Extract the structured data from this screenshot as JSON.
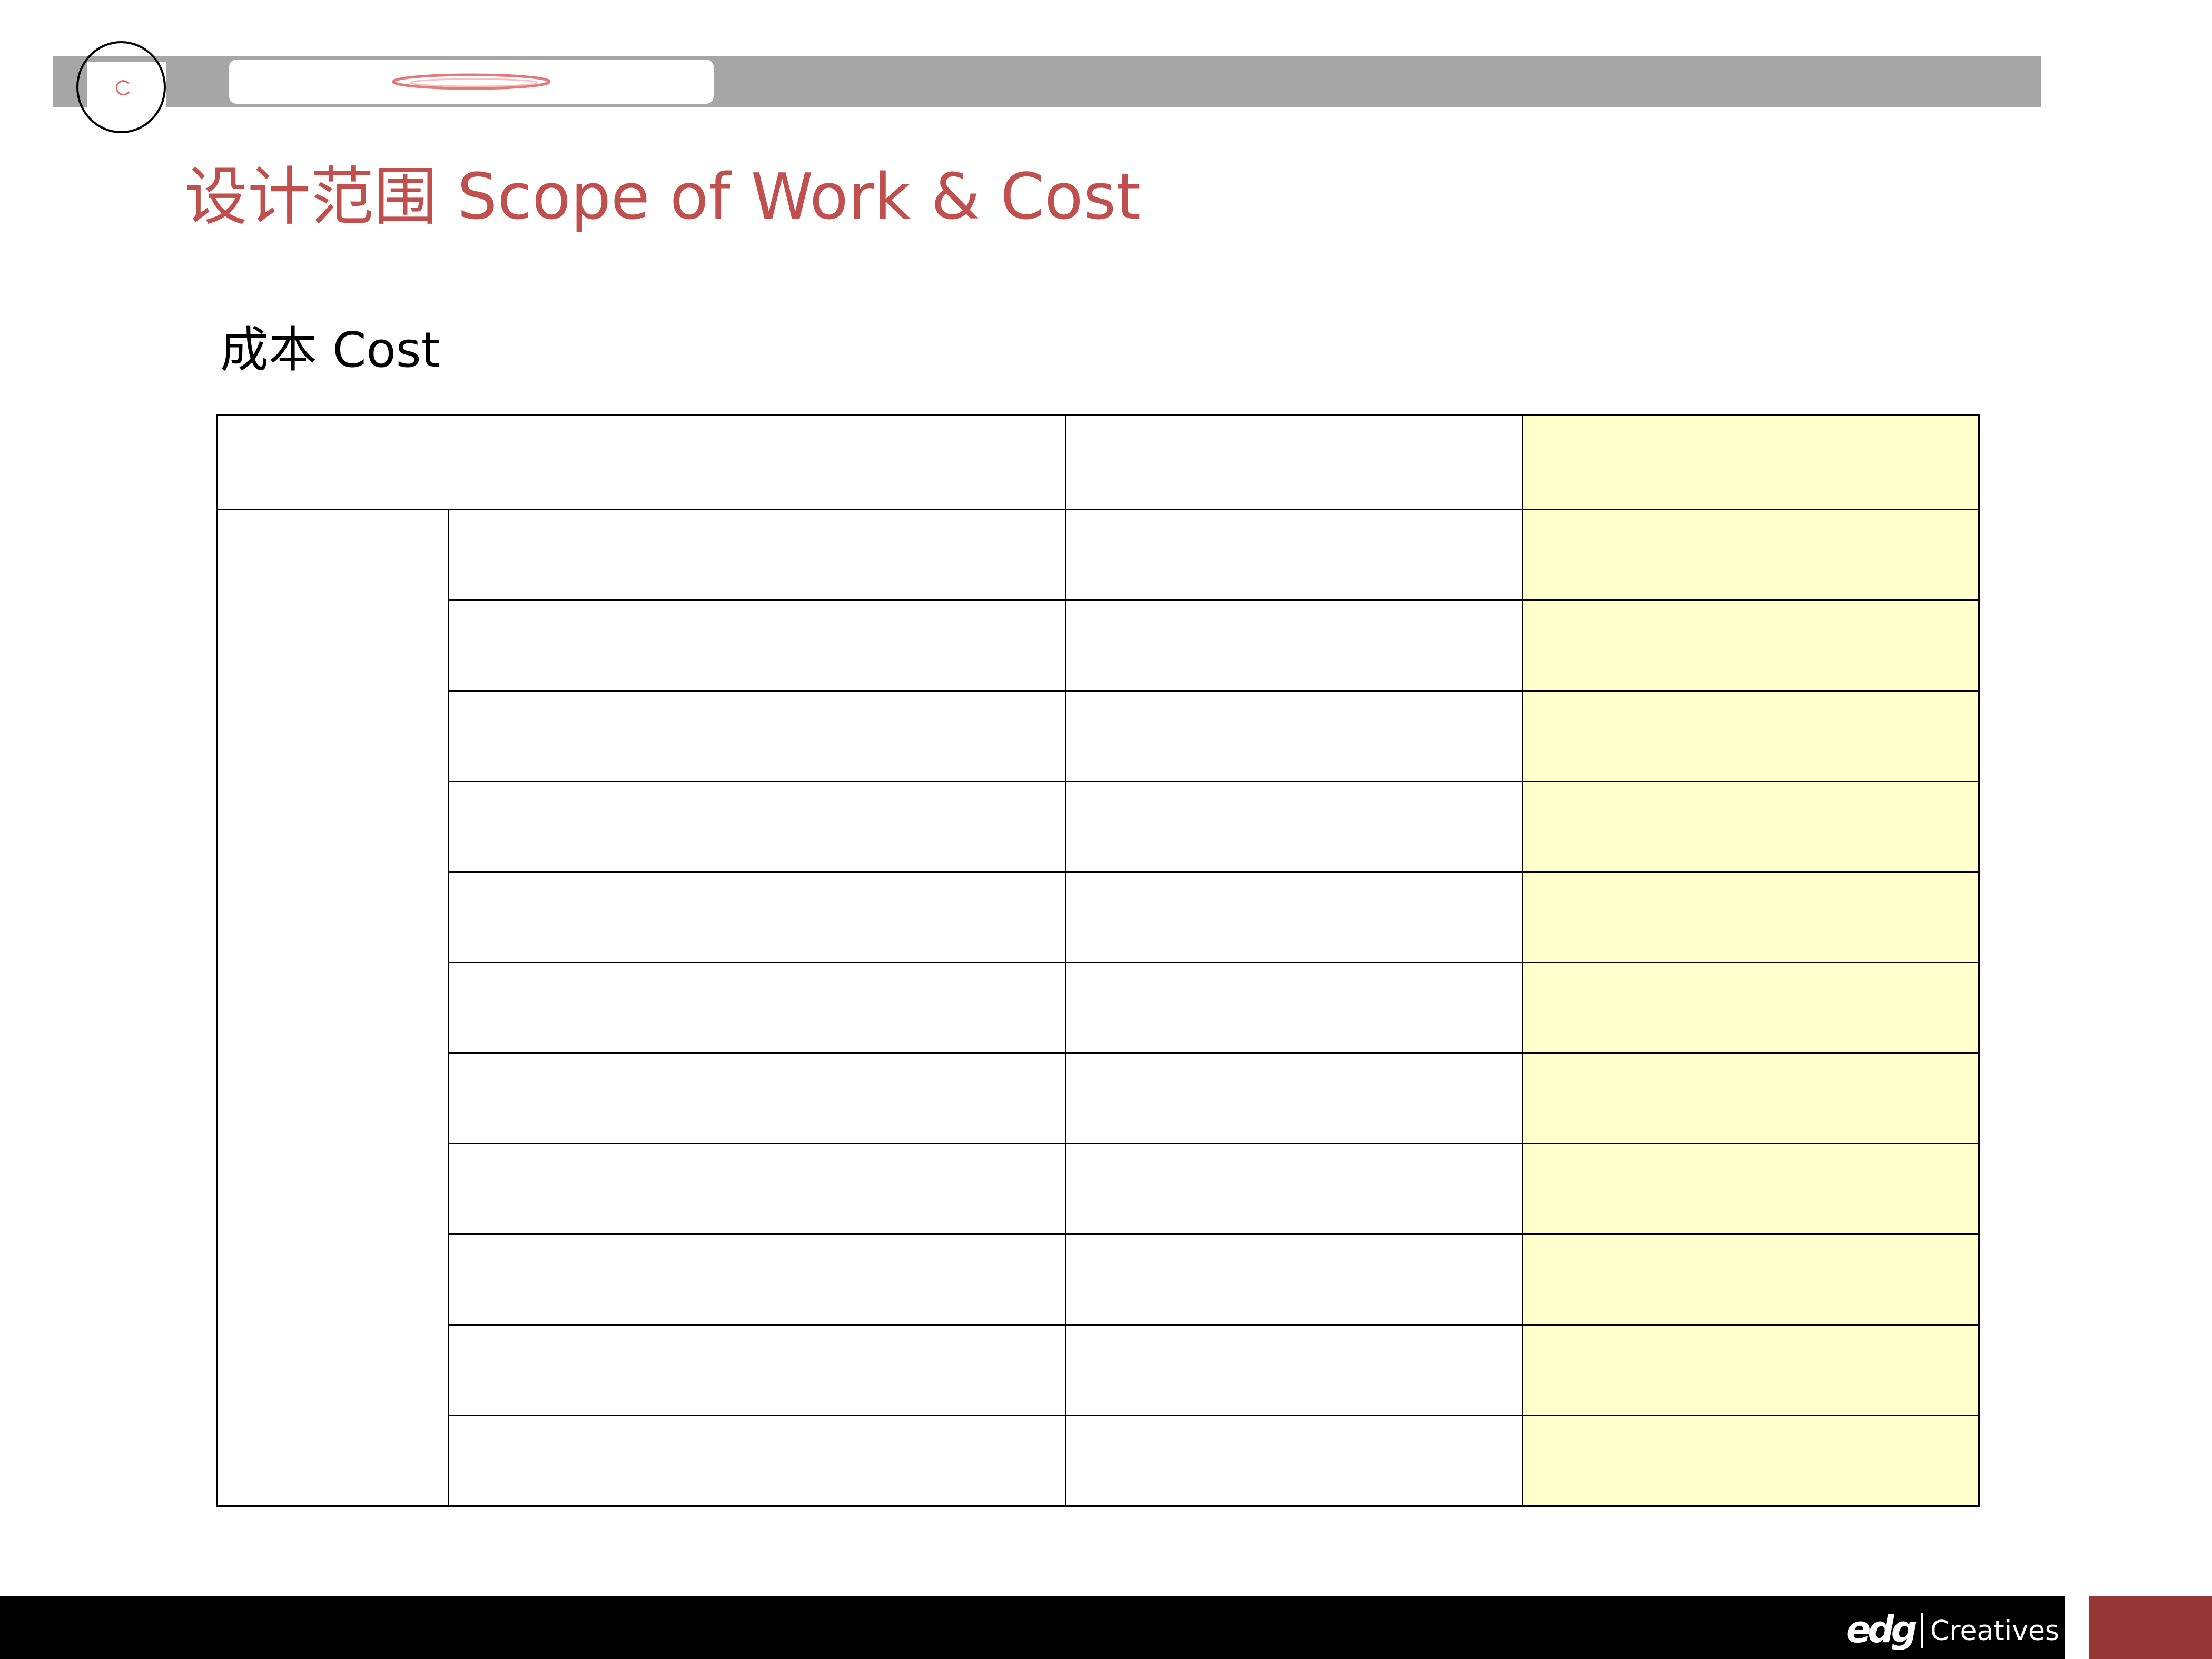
{
  "slide": {
    "title": "设计范围 Scope of Work & Cost",
    "subtitle": "成本 Cost"
  },
  "cost_table": {
    "header_row": [
      "",
      "",
      ""
    ],
    "group_label": "",
    "rows": [
      [
        "",
        "",
        ""
      ],
      [
        "",
        "",
        ""
      ],
      [
        "",
        "",
        ""
      ],
      [
        "",
        "",
        ""
      ],
      [
        "",
        "",
        ""
      ],
      [
        "",
        "",
        ""
      ],
      [
        "",
        "",
        ""
      ],
      [
        "",
        "",
        ""
      ],
      [
        "",
        "",
        ""
      ],
      [
        "",
        "",
        ""
      ],
      [
        "",
        "",
        ""
      ]
    ]
  },
  "footer": {
    "brand_mark": "edg",
    "brand_name": "Creatives"
  },
  "colors": {
    "title": "#c0504d",
    "highlight_column": "#ffffcc",
    "header_bar": "#a6a6a6",
    "footer_bar": "#000000",
    "footer_accent": "#953735"
  }
}
